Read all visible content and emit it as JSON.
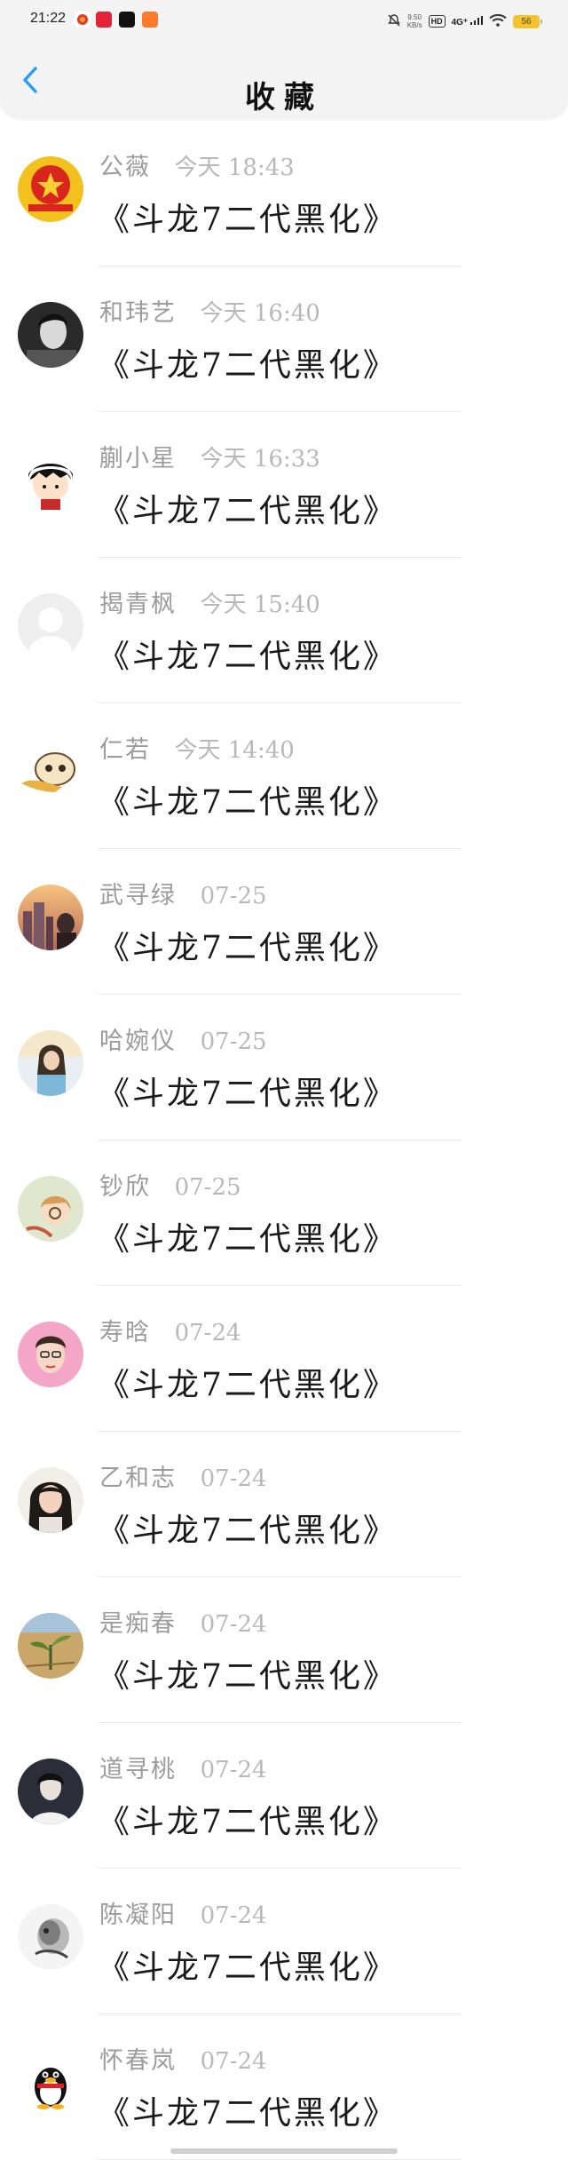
{
  "status_bar": {
    "time": "21:22",
    "net_speed_value": "9.50",
    "net_speed_unit": "KB/s",
    "hd_label": "HD",
    "network_label": "4G⁺",
    "battery_level": "56"
  },
  "header": {
    "title": "收藏"
  },
  "favorites": [
    {
      "name": "公薇",
      "time": "今天 18:43",
      "title": "《斗龙7二代黑化》",
      "avatar": "emblem-icon"
    },
    {
      "name": "和玮艺",
      "time": "今天 16:40",
      "title": "《斗龙7二代黑化》",
      "avatar": "bw-portrait-icon"
    },
    {
      "name": "蒯小星",
      "time": "今天 16:33",
      "title": "《斗龙7二代黑化》",
      "avatar": "cartoon-girl-icon"
    },
    {
      "name": "揭青枫",
      "time": "今天 15:40",
      "title": "《斗龙7二代黑化》",
      "avatar": "default-user-icon"
    },
    {
      "name": "仁若",
      "time": "今天 14:40",
      "title": "《斗龙7二代黑化》",
      "avatar": "cartoon-cat-icon"
    },
    {
      "name": "武寻绿",
      "time": "07-25",
      "title": "《斗龙7二代黑化》",
      "avatar": "city-sunset-icon"
    },
    {
      "name": "哈婉仪",
      "time": "07-25",
      "title": "《斗龙7二代黑化》",
      "avatar": "girl-photo-icon"
    },
    {
      "name": "钞欣",
      "time": "07-25",
      "title": "《斗龙7二代黑化》",
      "avatar": "anime-girl-icon"
    },
    {
      "name": "寿晗",
      "time": "07-24",
      "title": "《斗龙7二代黑化》",
      "avatar": "pink-portrait-icon"
    },
    {
      "name": "乙和志",
      "time": "07-24",
      "title": "《斗龙7二代黑化》",
      "avatar": "woman-portrait-icon"
    },
    {
      "name": "是痴春",
      "time": "07-24",
      "title": "《斗龙7二代黑化》",
      "avatar": "sprout-icon"
    },
    {
      "name": "道寻桃",
      "time": "07-24",
      "title": "《斗龙7二代黑化》",
      "avatar": "dark-portrait-icon"
    },
    {
      "name": "陈凝阳",
      "time": "07-24",
      "title": "《斗龙7二代黑化》",
      "avatar": "ink-sketch-icon"
    },
    {
      "name": "怀春岚",
      "time": "07-24",
      "title": "《斗龙7二代黑化》",
      "avatar": "penguin-icon"
    }
  ],
  "colors": {
    "accent": "#2a9cf5",
    "bar_background": "#f3f3f3",
    "meta_text": "#9c9c9c",
    "title_text": "#1a1a1a"
  }
}
